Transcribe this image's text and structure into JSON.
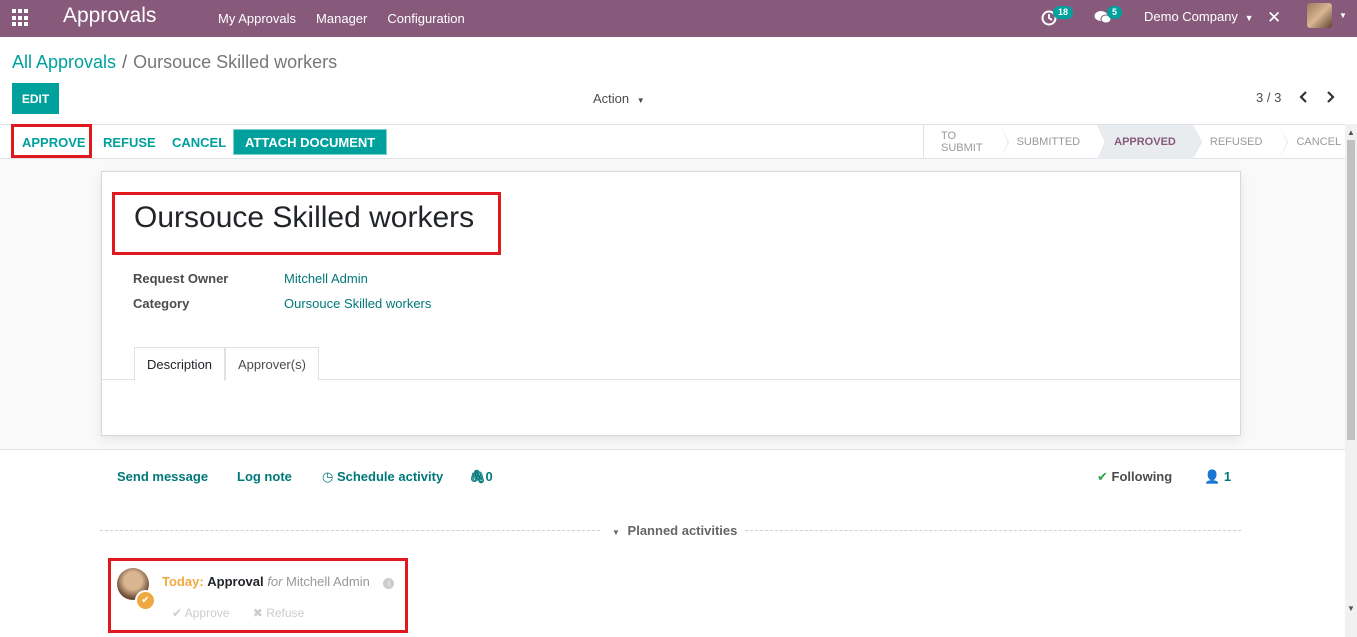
{
  "navbar": {
    "app_title": "Approvals",
    "menu": [
      "My Approvals",
      "Manager",
      "Configuration"
    ],
    "activity_count": "18",
    "message_count": "5",
    "company": "Demo Company",
    "bg_color": "#875a7b"
  },
  "breadcrumb": {
    "parent": "All Approvals",
    "separator": "/",
    "current": "Oursouce Skilled workers"
  },
  "control": {
    "edit_label": "EDIT",
    "action_label": "Action",
    "pager": "3 / 3"
  },
  "statusbar": {
    "buttons": [
      "APPROVE",
      "REFUSE",
      "CANCEL",
      "ATTACH DOCUMENT"
    ],
    "stages": [
      "TO SUBMIT",
      "SUBMITTED",
      "APPROVED",
      "REFUSED",
      "CANCEL"
    ],
    "active_stage": "APPROVED"
  },
  "form": {
    "title": "Oursouce Skilled workers",
    "fields": [
      {
        "label": "Request Owner",
        "value": "Mitchell Admin"
      },
      {
        "label": "Category",
        "value": "Oursouce Skilled workers"
      }
    ],
    "tabs": [
      "Description",
      "Approver(s)"
    ],
    "active_tab": "Description"
  },
  "chatter": {
    "send_message": "Send message",
    "log_note": "Log note",
    "schedule_activity": "Schedule activity",
    "attachments": "0",
    "following": "Following",
    "followers": "1",
    "planned_activities": "Planned activities"
  },
  "activity": {
    "when": "Today:",
    "type": "Approval",
    "for_text": "for",
    "user": "Mitchell Admin",
    "approve": "Approve",
    "refuse": "Refuse"
  },
  "colors": {
    "accent": "#00a09d",
    "brand": "#875a7b",
    "highlight_box": "#e0191f",
    "activity_today": "#f0a940"
  }
}
